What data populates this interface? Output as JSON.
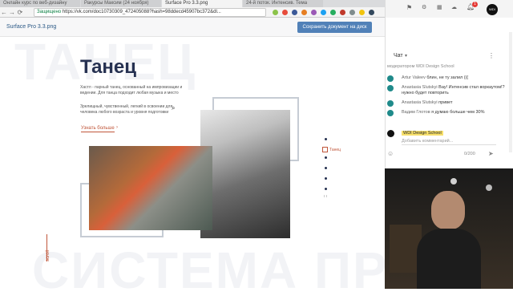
{
  "browser": {
    "tabs": [
      {
        "label": "Онлайн курс по веб-дизайну",
        "active": false
      },
      {
        "label": "Ракурсы Максим (24 ноября)",
        "active": false
      },
      {
        "label": "Surface Pro 3.3.png",
        "active": true
      },
      {
        "label": "24-й поток. Интенсив. Тема",
        "active": false
      }
    ],
    "back_icon": "back-arrow-icon",
    "forward_icon": "forward-arrow-icon",
    "reload_icon": "reload-icon",
    "secure_label": "Защищено",
    "url": "https://vk.com/doc10730309_472405088?hash=98ddecd45907bc372&dl..."
  },
  "viewer": {
    "title": "Surface Pro 3.3.png",
    "save_button": "Сохранить документ на диск"
  },
  "page": {
    "bg_word_top": "ТАНЕЦ",
    "bg_word_bottom": "СИСТЕМА ПР",
    "heading": "Танец",
    "para1": "Хастл - парный танец, основанный на импровизации и ведении. Для танца подходит любая музыка и место",
    "para2": "Зрелищный, чувственный, легкий в освоении для человека любого возраста и уровня подготовки",
    "more_link": "Узнать больше",
    "side_nav_active": "Танец",
    "scroll_label": "scroll"
  },
  "chat": {
    "title": "Чат",
    "moderator_note": "модератором WDI Design School",
    "messages": [
      {
        "name": "Artur Valeev",
        "text": "блин, не ту залил (((",
        "avatar_color": "#1f8a8a"
      },
      {
        "name": "Anastasia Slutskyi",
        "text": "Вау! Интенсив стал воркаутом!? нужно будет повторить",
        "avatar_color": "#1f8a8a"
      },
      {
        "name": "Anastasia Slutskyi",
        "text": "привет",
        "avatar_color": "#1f8a8a"
      },
      {
        "name": "Вадим Глотов",
        "text": "я думаю больше чем 30%",
        "avatar_color": "#1f8a8a"
      }
    ],
    "author_badge": "WDI Design School",
    "comment_placeholder": "Добавить комментарий...",
    "char_counter": "0/200",
    "notification_count": "1"
  }
}
